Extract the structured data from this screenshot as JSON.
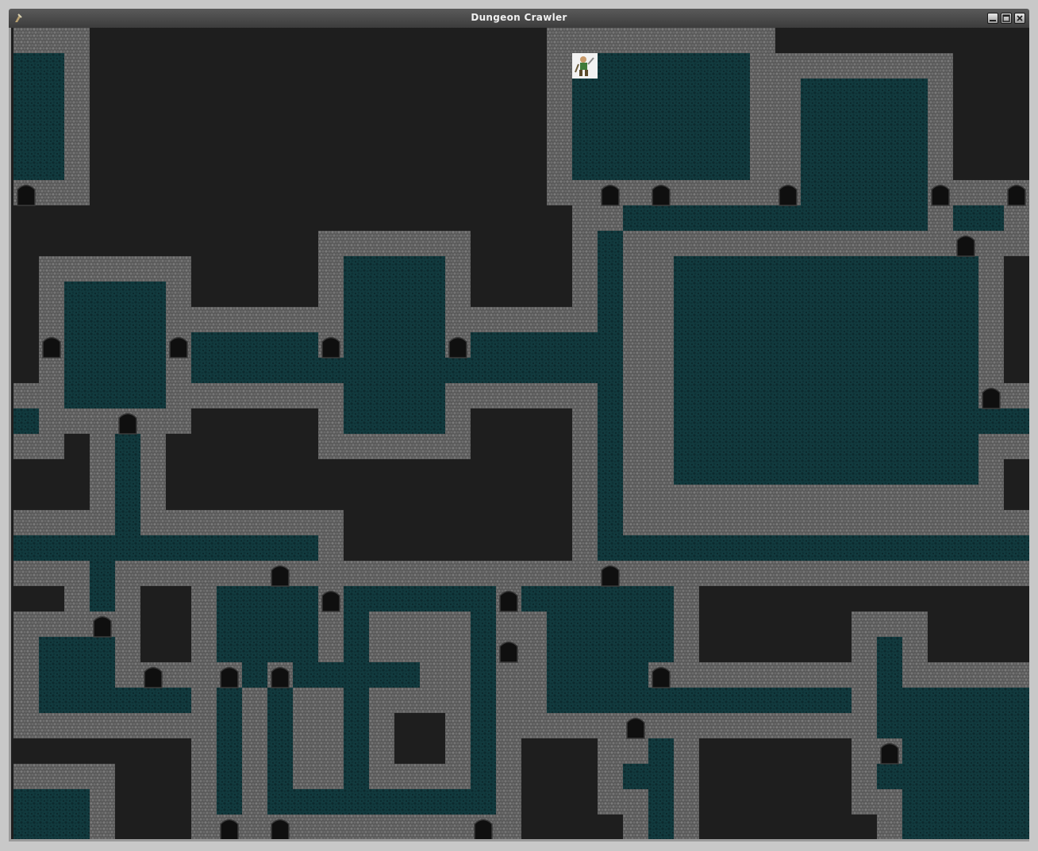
{
  "window": {
    "title": "Dungeon Crawler",
    "buttons": [
      "minimize",
      "maximize",
      "close"
    ]
  },
  "colors": {
    "void": "#1e1e1e",
    "stone": "#5d5d5d",
    "stone_dark": "#444444",
    "stone_light": "#7a7a7a",
    "floor": "#123b3f",
    "floor_dark": "#0c2a2e",
    "door": "#0f0f0f"
  },
  "player": {
    "icon": "hero-sprite-icon",
    "col": 22,
    "row": 1
  },
  "rooms": [
    [
      0,
      1,
      2,
      5
    ],
    [
      2,
      10,
      4,
      5
    ],
    [
      13,
      9,
      4,
      7
    ],
    [
      22,
      1,
      7,
      5
    ],
    [
      31,
      2,
      5,
      6
    ],
    [
      26,
      9,
      12,
      9
    ],
    [
      8,
      22,
      4,
      3
    ],
    [
      21,
      22,
      5,
      5
    ],
    [
      1,
      24,
      3,
      3
    ],
    [
      0,
      30,
      3,
      3
    ],
    [
      35,
      26,
      5,
      7
    ]
  ],
  "corridors": [
    [
      7,
      12,
      6,
      2
    ],
    [
      17,
      12,
      7,
      2
    ],
    [
      4,
      16,
      1,
      5
    ],
    [
      23,
      8,
      1,
      14
    ],
    [
      24,
      7,
      7,
      1
    ],
    [
      0,
      20,
      12,
      1
    ],
    [
      3,
      21,
      1,
      3
    ],
    [
      12,
      22,
      10,
      1
    ],
    [
      8,
      25,
      8,
      1
    ],
    [
      13,
      23,
      1,
      8
    ],
    [
      18,
      23,
      1,
      9
    ],
    [
      10,
      30,
      9,
      1
    ],
    [
      8,
      26,
      1,
      6
    ],
    [
      10,
      26,
      1,
      6
    ],
    [
      3,
      26,
      4,
      1
    ],
    [
      26,
      26,
      7,
      1
    ],
    [
      34,
      24,
      1,
      6
    ],
    [
      25,
      28,
      1,
      4
    ],
    [
      24,
      29,
      2,
      1
    ],
    [
      24,
      20,
      16,
      1
    ],
    [
      30,
      7,
      1,
      1
    ],
    [
      37,
      7,
      2,
      1
    ],
    [
      37,
      7,
      1,
      2
    ],
    [
      38,
      15,
      2,
      1
    ],
    [
      0,
      15,
      1,
      1
    ]
  ],
  "doors": [
    [
      0,
      6
    ],
    [
      23,
      6
    ],
    [
      25,
      6
    ],
    [
      30,
      6
    ],
    [
      36,
      6
    ],
    [
      39,
      6
    ],
    [
      37,
      8
    ],
    [
      1,
      12
    ],
    [
      6,
      12
    ],
    [
      12,
      12
    ],
    [
      17,
      12
    ],
    [
      38,
      14
    ],
    [
      4,
      15
    ],
    [
      10,
      21
    ],
    [
      23,
      21
    ],
    [
      3,
      23
    ],
    [
      12,
      22
    ],
    [
      19,
      22
    ],
    [
      19,
      24
    ],
    [
      5,
      25
    ],
    [
      8,
      25
    ],
    [
      10,
      25
    ],
    [
      25,
      25
    ],
    [
      24,
      27
    ],
    [
      34,
      28
    ],
    [
      8,
      31
    ],
    [
      10,
      31
    ],
    [
      18,
      31
    ]
  ]
}
